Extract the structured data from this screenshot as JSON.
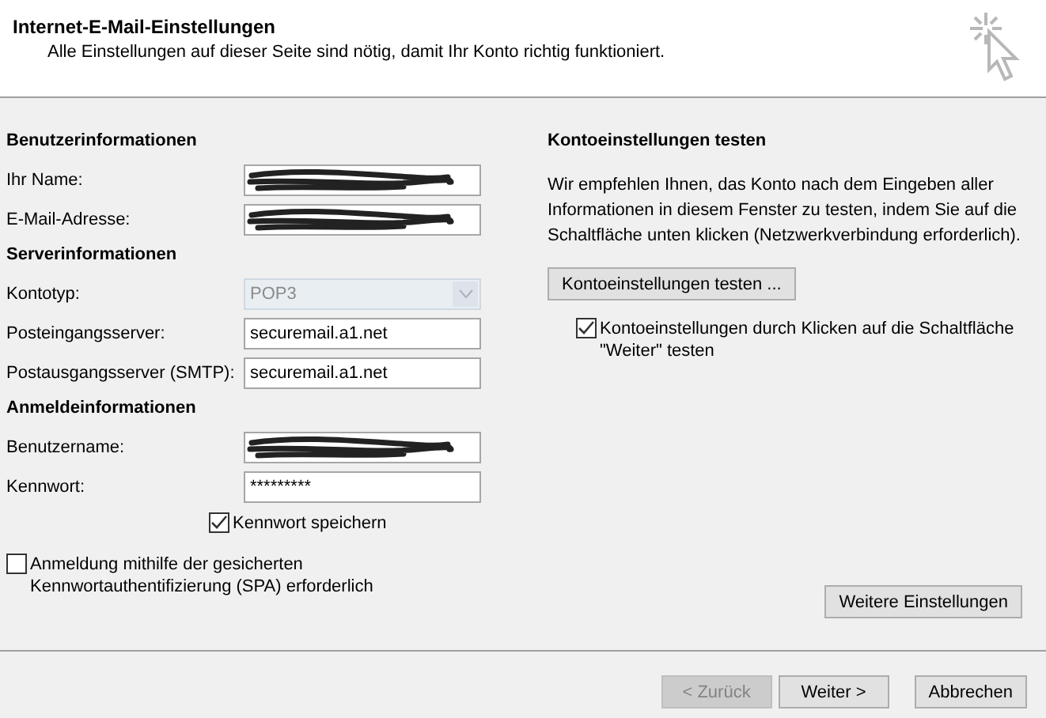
{
  "header": {
    "title": "Internet-E-Mail-Einstellungen",
    "subtitle": "Alle Einstellungen auf dieser Seite sind nötig, damit Ihr Konto richtig funktioniert."
  },
  "sections": [
    {
      "heading": "Benutzerinformationen",
      "fields": [
        {
          "kind": "redacted",
          "label": "Ihr Name:"
        },
        {
          "kind": "redacted",
          "label": "E-Mail-Adresse:"
        }
      ]
    },
    {
      "heading": "Serverinformationen",
      "fields": [
        {
          "kind": "dropdown",
          "label": "Kontotyp:",
          "value": "POP3",
          "disabled": true
        },
        {
          "kind": "text",
          "label": "Posteingangsserver:",
          "value": "securemail.a1.net"
        },
        {
          "kind": "text",
          "label": "Postausgangsserver (SMTP):",
          "value": "securemail.a1.net"
        }
      ]
    },
    {
      "heading": "Anmeldeinformationen",
      "fields": [
        {
          "kind": "redacted",
          "label": "Benutzername:"
        },
        {
          "kind": "text",
          "label": "Kennwort:",
          "value": "*********"
        }
      ]
    }
  ],
  "remember_password": {
    "label": "Kennwort speichern",
    "checked": true
  },
  "spa": {
    "label": "Anmeldung mithilfe der gesicherten Kennwortauthentifizierung (SPA) erforderlich",
    "checked": false
  },
  "test": {
    "heading": "Kontoeinstellungen testen",
    "text": "Wir empfehlen Ihnen, das Konto nach dem Eingeben aller Informationen in diesem Fenster zu testen, indem Sie auf die Schaltfläche unten klicken (Netzwerkverbindung erforderlich).",
    "button": "Kontoeinstellungen testen ...",
    "auto_test": {
      "label": "Kontoeinstellungen durch Klicken auf die Schaltfläche \"Weiter\" testen",
      "checked": true
    }
  },
  "more_button": "Weitere Einstellungen",
  "footer_buttons": [
    {
      "label": "< Zurück",
      "disabled": true
    },
    {
      "label": "Weiter >",
      "disabled": false
    },
    {
      "label": "Abbrechen",
      "disabled": false
    }
  ]
}
